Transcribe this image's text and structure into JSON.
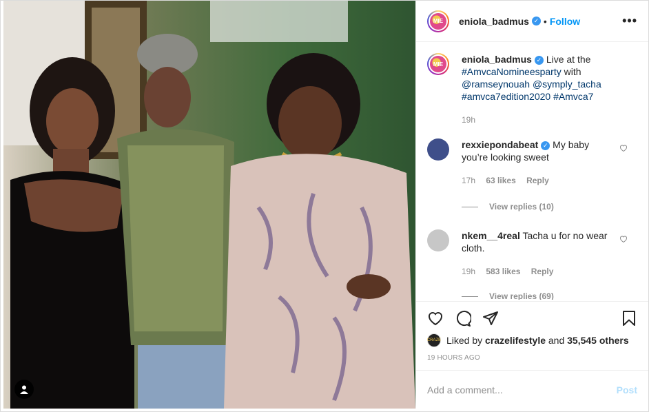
{
  "post": {
    "username": "eniola_badmus",
    "follow_label": "Follow",
    "separator": "•",
    "more_label": "•••",
    "caption": {
      "username": "eniola_badmus",
      "text_before": "Live at the",
      "tag1": "#AmvcaNomineesparty",
      "text_with": "with",
      "mention1": "@ramseynouah",
      "mention2": "@symply_tacha",
      "tag2": "#amvca7edition2020",
      "tag3": "#Amvca7",
      "time": "19h"
    },
    "likes_by": "crazelifestyle",
    "likes_others": "35,545 others",
    "likes_prefix": "Liked by",
    "likes_and": "and",
    "posted_ago": "19 HOURS AGO",
    "avatar_text": "MIE"
  },
  "comments": [
    {
      "username": "rexxiepondabeat",
      "text": "My baby you’re looking sweet",
      "time": "17h",
      "likes": "63 likes",
      "reply": "Reply",
      "view_replies": "View replies (10)"
    },
    {
      "username": "nkem__4real",
      "text": "Tacha u for no wear cloth.",
      "time": "19h",
      "likes": "583 likes",
      "reply": "Reply",
      "view_replies": "View replies (69)"
    }
  ],
  "composer": {
    "placeholder": "Add a comment...",
    "post_label": "Post"
  },
  "icons": {
    "like": "heart-icon",
    "comment": "comment-icon",
    "share": "paper-plane-icon",
    "save": "bookmark-icon",
    "tags": "user-tag-icon",
    "verified": "verified-badge-icon"
  },
  "colors": {
    "link": "#00376b",
    "follow": "#0095f6",
    "verified": "#3897f0",
    "post_disabled": "#b2dffc"
  }
}
